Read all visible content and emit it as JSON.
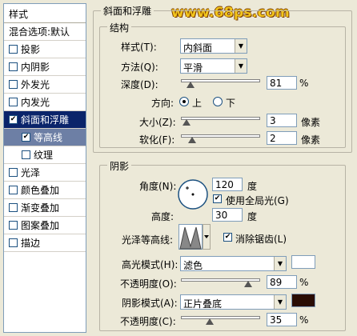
{
  "watermark": "www.68ps.com",
  "sidebar": {
    "header": "样式",
    "items": [
      {
        "label": "混合选项:默认",
        "check": false,
        "type": "plain"
      },
      {
        "label": "投影",
        "check": false,
        "type": "normal"
      },
      {
        "label": "内阴影",
        "check": false,
        "type": "normal"
      },
      {
        "label": "外发光",
        "check": false,
        "type": "normal"
      },
      {
        "label": "内发光",
        "check": false,
        "type": "normal"
      },
      {
        "label": "斜面和浮雕",
        "check": true,
        "type": "selected"
      },
      {
        "label": "等高线",
        "check": true,
        "type": "subsel"
      },
      {
        "label": "纹理",
        "check": false,
        "type": "sub"
      },
      {
        "label": "光泽",
        "check": false,
        "type": "normal"
      },
      {
        "label": "颜色叠加",
        "check": false,
        "type": "normal"
      },
      {
        "label": "渐变叠加",
        "check": false,
        "type": "normal"
      },
      {
        "label": "图案叠加",
        "check": false,
        "type": "normal"
      },
      {
        "label": "描边",
        "check": false,
        "type": "normal"
      }
    ]
  },
  "bevel": {
    "title": "斜面和浮雕",
    "structure": {
      "title": "结构",
      "style_label": "样式(T):",
      "style_value": "内斜面",
      "technique_label": "方法(Q):",
      "technique_value": "平滑",
      "depth_label": "深度(D):",
      "depth_value": "81",
      "depth_pct": 0.08,
      "depth_unit": "%",
      "direction_label": "方向:",
      "dir_up": "上",
      "dir_down": "下",
      "size_label": "大小(Z):",
      "size_value": "3",
      "size_pct": 0.02,
      "size_unit": "像素",
      "soften_label": "软化(F):",
      "soften_value": "2",
      "soften_pct": 0.1,
      "soften_unit": "像素"
    },
    "shading": {
      "title": "阴影",
      "angle_label": "角度(N):",
      "angle_value": "120",
      "angle_unit": "度",
      "global_light_label": "使用全局光(G)",
      "altitude_label": "高度:",
      "altitude_value": "30",
      "altitude_unit": "度",
      "gloss_label": "光泽等高线:",
      "antialias_label": "消除锯齿(L)",
      "highlight_label": "高光模式(H):",
      "highlight_mode": "滤色",
      "highlight_color": "#ffffff",
      "highlight_opacity_label": "不透明度(O):",
      "highlight_opacity": "89",
      "highlight_opacity_pct": 0.89,
      "opacity_unit": "%",
      "shadow_label": "阴影模式(A):",
      "shadow_mode": "正片叠底",
      "shadow_color": "#2a0d04",
      "shadow_opacity_label": "不透明度(C):",
      "shadow_opacity": "35",
      "shadow_opacity_pct": 0.35
    }
  }
}
